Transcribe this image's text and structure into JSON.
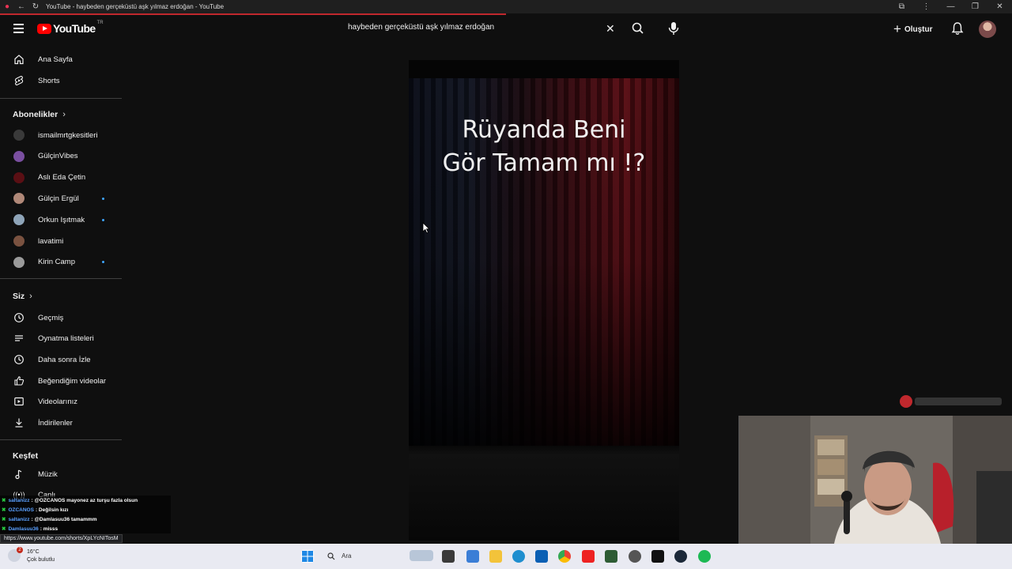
{
  "browser": {
    "tab_title": "YouTube - haybeden gerçeküstü aşk yılmaz erdoğan - YouTube",
    "status_url": "https://www.youtube.com/shorts/XpLYcNITosM"
  },
  "header": {
    "logo_text": "YouTube",
    "country_code": "TR",
    "search_query": "haybeden gerçeküstü aşk yılmaz erdoğan",
    "create_label": "Oluştur"
  },
  "sidebar": {
    "main": [
      {
        "label": "Ana Sayfa",
        "icon": "home-icon"
      },
      {
        "label": "Shorts",
        "icon": "shorts-icon"
      }
    ],
    "subscriptions_heading": "Abonelikler",
    "subscriptions": [
      {
        "label": "ismailmrtgkesitleri",
        "new": false,
        "color": "#3a3a3a"
      },
      {
        "label": "GülçinVibes",
        "new": false,
        "color": "#7a4fa0"
      },
      {
        "label": "Aslı Eda Çetin",
        "new": false,
        "color": "#5a0f14"
      },
      {
        "label": "Gülçin Ergül",
        "new": true,
        "color": "#b08878"
      },
      {
        "label": "Orkun Işıtmak",
        "new": true,
        "color": "#8ea4b8"
      },
      {
        "label": "lavatimi",
        "new": false,
        "color": "#7a5240"
      },
      {
        "label": "Kirin Camp",
        "new": true,
        "color": "#9a9a9a"
      }
    ],
    "you_heading": "Siz",
    "you": [
      {
        "label": "Geçmiş",
        "icon": "history-icon"
      },
      {
        "label": "Oynatma listeleri",
        "icon": "playlists-icon"
      },
      {
        "label": "Daha sonra İzle",
        "icon": "watch-later-icon"
      },
      {
        "label": "Beğendiğim videolar",
        "icon": "like-icon"
      },
      {
        "label": "Videolarınız",
        "icon": "your-videos-icon"
      },
      {
        "label": "İndirilenler",
        "icon": "download-icon"
      }
    ],
    "explore_heading": "Keşfet",
    "explore": [
      {
        "label": "Müzik",
        "icon": "music-icon"
      },
      {
        "label": "Canlı",
        "icon": "live-icon"
      }
    ]
  },
  "video": {
    "caption_line1": "Rüyanda Beni",
    "caption_line2": "Gör Tamam mı !?"
  },
  "chat": [
    {
      "user": "saltanizz",
      "message": ": @OZCANOS mayonez az turşu fazla olsun"
    },
    {
      "user": "OZCANOS",
      "message": ": Değilsin kızı"
    },
    {
      "user": "saltanizz",
      "message": ": @Damlasuu36 tamammm"
    },
    {
      "user": "Damlasuu36",
      "message": ": misss"
    }
  ],
  "taskbar": {
    "temperature": "16°C",
    "weather_desc": "Çok bulutlu",
    "notification_count": "2",
    "search_label": "Ara"
  },
  "colors": {
    "background": "#0f0f0f",
    "youtube_red": "#ff0000",
    "new_content_dot": "#3ea6ff",
    "chat_user": "#5aa0ff"
  }
}
